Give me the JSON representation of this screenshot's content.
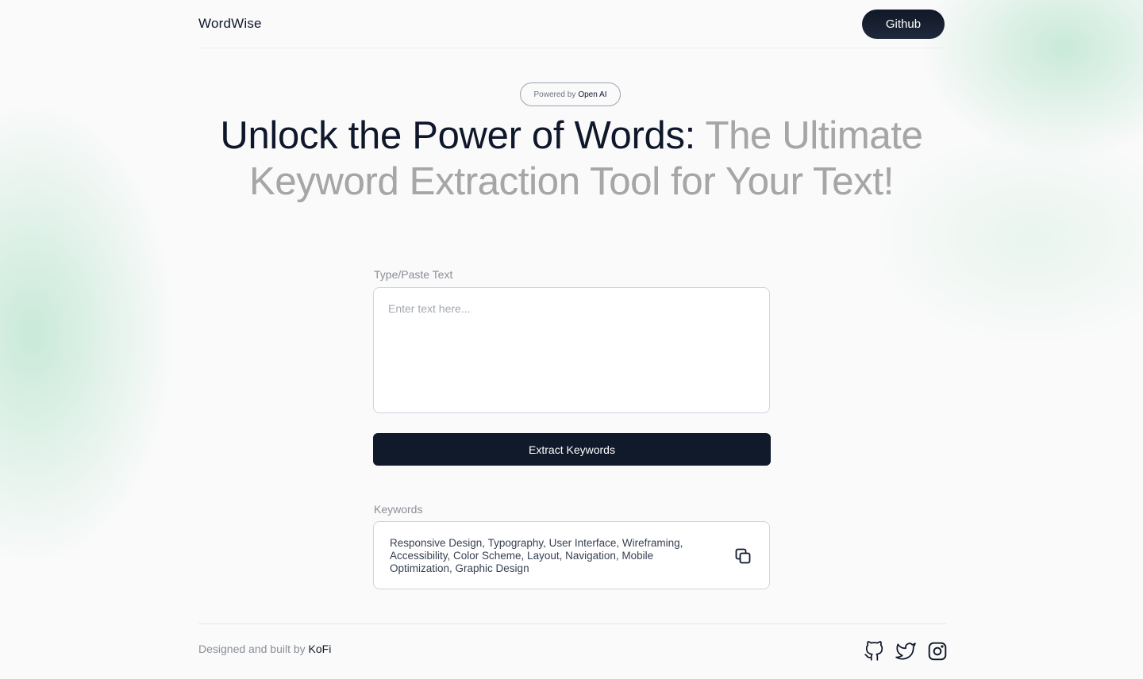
{
  "header": {
    "brand": "WordWise",
    "github_label": "Github"
  },
  "badge": {
    "prefix": "Powered by",
    "emphasis": "Open AI"
  },
  "hero": {
    "title_dark": "Unlock the Power of Words:",
    "title_light": "The Ultimate Keyword Extraction Tool for Your Text!"
  },
  "input": {
    "label": "Type/Paste Text",
    "placeholder": "Enter text here...",
    "value": ""
  },
  "actions": {
    "extract_label": "Extract Keywords"
  },
  "keywords": {
    "label": "Keywords",
    "value": "Responsive Design, Typography, User Interface, Wireframing, Accessibility, Color Scheme, Layout, Navigation, Mobile Optimization, Graphic Design",
    "copy_icon": "copy-icon"
  },
  "footer": {
    "credit_prefix": "Designed and built by",
    "credit_name": "KoFi",
    "socials": [
      "github-icon",
      "twitter-icon",
      "instagram-icon"
    ]
  },
  "colors": {
    "primary_dark": "#111a2b",
    "muted_text": "#8a8f98",
    "accent_glow": "#a0dcbe"
  }
}
